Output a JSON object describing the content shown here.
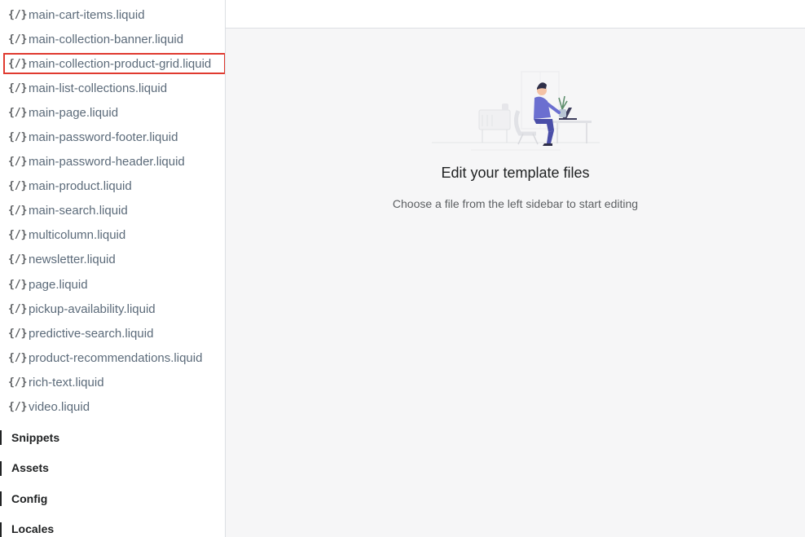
{
  "sidebar": {
    "files": [
      {
        "icon": "{/}",
        "label": "main-cart-items.liquid"
      },
      {
        "icon": "{/}",
        "label": "main-collection-banner.liquid"
      },
      {
        "icon": "{/}",
        "label": "main-collection-product-grid.liquid",
        "selected": true
      },
      {
        "icon": "{/}",
        "label": "main-list-collections.liquid"
      },
      {
        "icon": "{/}",
        "label": "main-page.liquid"
      },
      {
        "icon": "{/}",
        "label": "main-password-footer.liquid"
      },
      {
        "icon": "{/}",
        "label": "main-password-header.liquid"
      },
      {
        "icon": "{/}",
        "label": "main-product.liquid"
      },
      {
        "icon": "{/}",
        "label": "main-search.liquid"
      },
      {
        "icon": "{/}",
        "label": "multicolumn.liquid"
      },
      {
        "icon": "{/}",
        "label": "newsletter.liquid"
      },
      {
        "icon": "{/}",
        "label": "page.liquid"
      },
      {
        "icon": "{/}",
        "label": "pickup-availability.liquid"
      },
      {
        "icon": "{/}",
        "label": "predictive-search.liquid"
      },
      {
        "icon": "{/}",
        "label": "product-recommendations.liquid"
      },
      {
        "icon": "{/}",
        "label": "rich-text.liquid"
      },
      {
        "icon": "{/}",
        "label": "video.liquid"
      }
    ],
    "sections": [
      {
        "label": "Snippets"
      },
      {
        "label": "Assets"
      },
      {
        "label": "Config"
      },
      {
        "label": "Locales"
      }
    ],
    "selection_color": "#e03a2f"
  },
  "main": {
    "empty_title": "Edit your template files",
    "empty_subtitle": "Choose a file from the left sidebar to start editing",
    "illustration_icon": "person-at-desk-illustration"
  }
}
